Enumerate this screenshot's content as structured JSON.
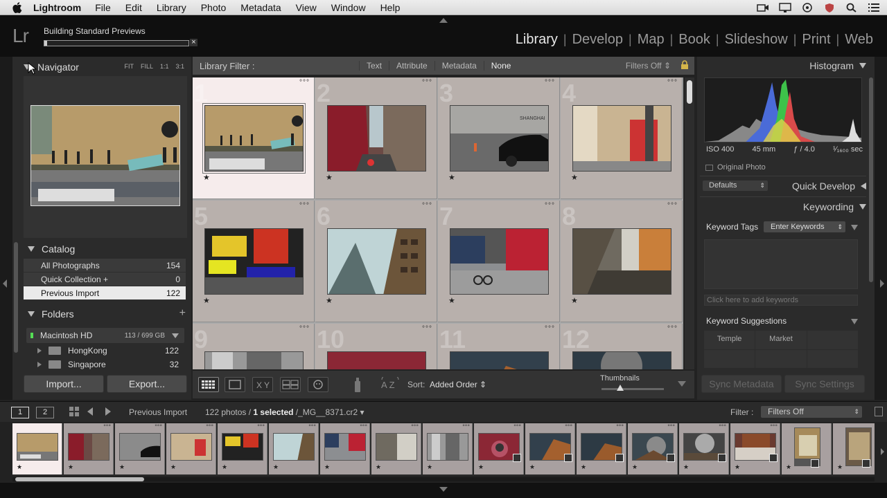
{
  "menubar": {
    "app_name": "Lightroom",
    "items": [
      "File",
      "Edit",
      "Library",
      "Photo",
      "Metadata",
      "View",
      "Window",
      "Help"
    ]
  },
  "identity": {
    "logo": "Lr",
    "task_text": "Building Standard Previews",
    "task_progress": 0.02,
    "cancel_glyph": "×"
  },
  "modules": [
    "Library",
    "Develop",
    "Map",
    "Book",
    "Slideshow",
    "Print",
    "Web"
  ],
  "active_module": "Library",
  "navigator": {
    "title": "Navigator",
    "zoom_options": [
      "FIT",
      "FILL",
      "1:1",
      "3:1"
    ]
  },
  "catalog": {
    "title": "Catalog",
    "rows": [
      {
        "label": "All Photographs",
        "count": "154"
      },
      {
        "label": "Quick Collection +",
        "count": "0"
      },
      {
        "label": "Previous Import",
        "count": "122"
      }
    ]
  },
  "folders": {
    "title": "Folders",
    "plus": "+",
    "volume": {
      "name": "Macintosh HD",
      "size": "113 / 699 GB"
    },
    "rows": [
      {
        "label": "HongKong",
        "count": "122"
      },
      {
        "label": "Singapore",
        "count": "32"
      }
    ]
  },
  "left_buttons": {
    "import": "Import...",
    "export": "Export..."
  },
  "filter_bar": {
    "title": "Library Filter :",
    "options": [
      "Text",
      "Attribute",
      "Metadata",
      "None"
    ],
    "active": "None",
    "filters_state": "Filters Off"
  },
  "grid": {
    "cells": [
      {
        "num": "1",
        "dots": "°°°",
        "star": "★"
      },
      {
        "num": "2",
        "dots": "°°°",
        "star": "★"
      },
      {
        "num": "3",
        "dots": "°°°",
        "star": "★"
      },
      {
        "num": "4",
        "dots": "°°°",
        "star": "★"
      },
      {
        "num": "5",
        "dots": "°°°",
        "star": "★"
      },
      {
        "num": "6",
        "dots": "°°°",
        "star": "★"
      },
      {
        "num": "7",
        "dots": "°°°",
        "star": "★"
      },
      {
        "num": "8",
        "dots": "°°°",
        "star": "★"
      },
      {
        "num": "9",
        "dots": "°°°",
        "star": ""
      },
      {
        "num": "10",
        "dots": "°°°",
        "star": ""
      },
      {
        "num": "11",
        "dots": "°°°",
        "star": ""
      },
      {
        "num": "12",
        "dots": "°°°",
        "star": ""
      }
    ]
  },
  "toolbar": {
    "sort_label": "Sort:",
    "sort_value": "Added Order",
    "thumbnails_label": "Thumbnails",
    "thumbnail_size": 0.3
  },
  "histogram": {
    "title": "Histogram",
    "iso": "ISO 400",
    "focal": "45 mm",
    "aperture": "ƒ / 4.0",
    "shutter": "¹⁄₁₆₀₀ sec",
    "original_photo": "Original Photo"
  },
  "quick_develop": {
    "defaults": "Defaults",
    "title": "Quick Develop"
  },
  "keywording": {
    "title": "Keywording",
    "tags_label": "Keyword Tags",
    "enter_keywords": "Enter Keywords",
    "add_placeholder": "Click here to add keywords",
    "suggestions_label": "Keyword Suggestions",
    "suggestions": [
      "Temple",
      "Market",
      "",
      "",
      "",
      ""
    ]
  },
  "right_buttons": {
    "sync_metadata": "Sync Metadata",
    "sync_settings": "Sync Settings"
  },
  "filmstrip_header": {
    "monitor1": "1",
    "monitor2": "2",
    "source": "Previous Import",
    "count_prefix": "122 photos /",
    "selected": "1 selected",
    "filename": "/_MG__8371.cr2 ▾",
    "filter_label": "Filter :",
    "filter_value": "Filters Off"
  },
  "filmstrip": {
    "cells": [
      "",
      "",
      "",
      "",
      "",
      "",
      "",
      "",
      "",
      "",
      "",
      "",
      "",
      "",
      "",
      "",
      ""
    ]
  }
}
